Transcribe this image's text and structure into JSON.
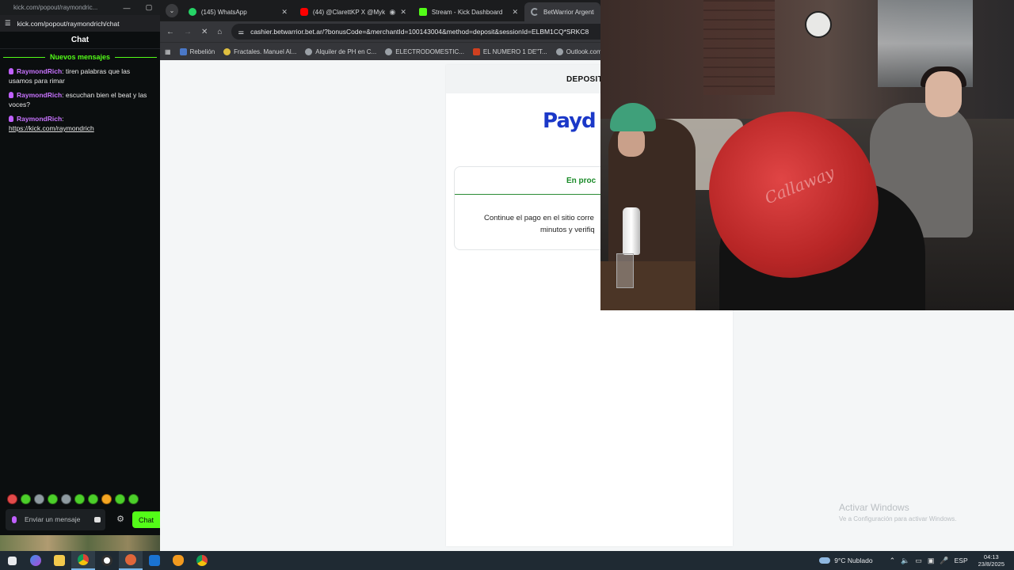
{
  "chat_window": {
    "title": "kick.com/popout/raymondric...",
    "url": "kick.com/popout/raymondrich/chat",
    "header": "Chat",
    "new_messages_label": "Nuevos mensajes",
    "messages": [
      {
        "user": "RaymondRich",
        "text": ": tiren palabras que las usamos para rimar"
      },
      {
        "user": "RaymondRich",
        "text": ": escuchan bien el beat y las voces?"
      },
      {
        "user": "RaymondRich",
        "text": ":",
        "link": "https://kick.com/raymondrich"
      }
    ],
    "composer_placeholder": "Enviar un mensaje",
    "send_label": "Chat"
  },
  "browser": {
    "tabs": [
      {
        "label": "(145) WhatsApp",
        "favicon_color": "#25d366",
        "active": false
      },
      {
        "label": "(44) @ClarettKP X @Myke",
        "favicon_color": "#ff0000",
        "active": false
      },
      {
        "label": "Stream - Kick Dashboard",
        "favicon_color": "#53fc18",
        "active": false
      },
      {
        "label": "BetWarrior Argentin",
        "favicon_color": "#9aa0a6",
        "active": true
      }
    ],
    "url": "cashier.betwarrior.bet.ar/?bonusCode=&merchantId=100143004&method=deposit&sessionId=ELBM1CQ*SRKC8",
    "bookmarks": [
      {
        "label": "Rebelión",
        "icon_color": "#4a78c8"
      },
      {
        "label": "Fractales. Manuel Al...",
        "icon_color": "#e0c040"
      },
      {
        "label": "Alquiler de PH en C...",
        "icon_color": "#9aa0a6"
      },
      {
        "label": "ELECTRODOMESTIC...",
        "icon_color": "#9aa0a6"
      },
      {
        "label": "EL NUMERO 1 DE\"T...",
        "icon_color": "#d04020"
      },
      {
        "label": "Outlook.com - carol...",
        "icon_color": "#9aa0a6"
      }
    ]
  },
  "cashier": {
    "header": "DEPOSIT",
    "logo_text": "Payd",
    "status_title": "En proc",
    "status_line1": "Continue el pago en el sitio corre",
    "status_line2": "minutos y verifiq"
  },
  "watermark": {
    "line1": "Activar Windows",
    "line2": "Ve a Configuración para activar Windows."
  },
  "webcam": {
    "cap_text": "Callaway"
  },
  "taskbar": {
    "weather": "9°C Nublado",
    "language": "ESP",
    "time": "04:13",
    "date": "23/8/2025"
  }
}
